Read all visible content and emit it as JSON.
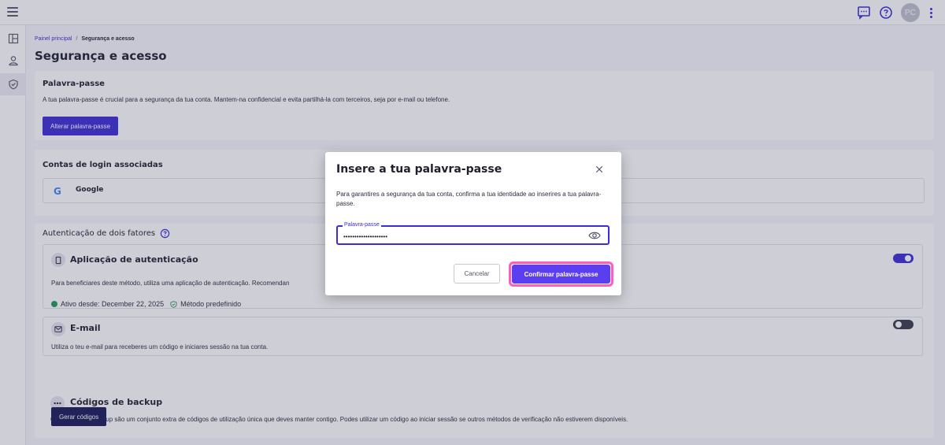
{
  "topbar": {
    "avatar_initials": "PC",
    "icons": [
      "hamburger-menu-icon",
      "chat-icon",
      "help-icon",
      "kebab-menu-icon"
    ]
  },
  "sidebar": {
    "items": [
      {
        "icon": "dashboard-icon",
        "active": false
      },
      {
        "icon": "user-icon",
        "active": false
      },
      {
        "icon": "shield-icon",
        "active": true
      }
    ]
  },
  "breadcrumb": {
    "home": "Painel principal",
    "separator": "/",
    "current": "Segurança e acesso"
  },
  "page": {
    "title": "Segurança e acesso"
  },
  "password_section": {
    "title": "Palavra-passe",
    "description": "A tua palavra-passe é crucial para a segurança da tua conta. Mantem-na confidencial e evita partilhá-la com terceiros, seja por e-mail ou telefone.",
    "button_label": "Alterar palavra-passe"
  },
  "linked_accounts": {
    "title": "Contas de login associadas",
    "provider_logo": "G",
    "provider": "Google"
  },
  "two_factor": {
    "title": "Autenticação de dois fatores",
    "methods": [
      {
        "icon": "phone-icon",
        "title": "Aplicação de autenticação",
        "description": "Para beneficiares deste método, utiliza uma aplicação de autenticação. Recomendan",
        "status": "Ativo desde: December 22, 2025",
        "default_label": "Método predefinido",
        "enabled": true
      },
      {
        "icon": "email-icon",
        "title": "E-mail",
        "description": "Utiliza o teu e-mail para receberes um código e iniciares sessão na tua conta.",
        "enabled": false
      },
      {
        "icon": "dots-icon",
        "title": "Códigos de backup",
        "description": "Os códigos de backup são um conjunto extra de códigos de utilização única que deves manter contigo. Podes utilizar um código ao iniciar sessão se outros métodos de verificação não estiverem disponíveis.",
        "button_label": "Gerar códigos"
      }
    ]
  },
  "modal": {
    "title": "Insere a tua palavra-passe",
    "text": "Para garantires a segurança da tua conta, confirma a tua identidade ao inserires a tua palavra-passe.",
    "field_label": "Palavra-passe",
    "field_value": "••••••••••••••••••••",
    "cancel_label": "Cancelar",
    "confirm_label": "Confirmar palavra-passe"
  },
  "colors": {
    "primary": "#3d2dd6",
    "confirm": "#5b3ef0",
    "focus_ring": "#ff5dbd",
    "success": "#1e9e57"
  }
}
